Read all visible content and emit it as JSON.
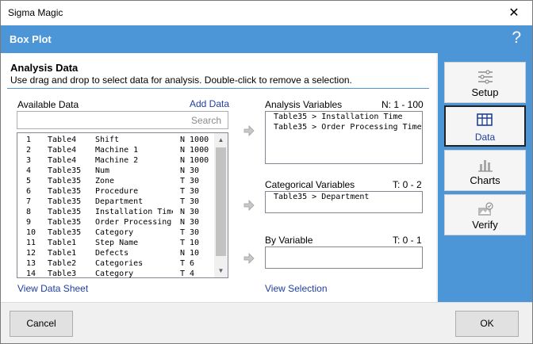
{
  "window": {
    "title": "Sigma Magic",
    "close_glyph": "✕"
  },
  "header": {
    "title": "Box Plot",
    "help": "?"
  },
  "section": {
    "title": "Analysis Data",
    "description": "Use drag and drop to select data for analysis. Double-click to remove a selection."
  },
  "available": {
    "label": "Available Data",
    "add_link": "Add Data",
    "search_placeholder": "Search",
    "rows": [
      [
        "1",
        "Table4",
        "Shift",
        "N 1000"
      ],
      [
        "2",
        "Table4",
        "Machine 1",
        "N 1000"
      ],
      [
        "3",
        "Table4",
        "Machine 2",
        "N 1000"
      ],
      [
        "4",
        "Table35",
        "Num",
        "N 30"
      ],
      [
        "5",
        "Table35",
        "Zone",
        "T 30"
      ],
      [
        "6",
        "Table35",
        "Procedure",
        "T 30"
      ],
      [
        "7",
        "Table35",
        "Department",
        "T 30"
      ],
      [
        "8",
        "Table35",
        "Installation Time",
        "N 30"
      ],
      [
        "9",
        "Table35",
        "Order Processing",
        "N 30"
      ],
      [
        "10",
        "Table35",
        "Category",
        "T 30"
      ],
      [
        "11",
        "Table1",
        "Step Name",
        "T 10"
      ],
      [
        "12",
        "Table1",
        "Defects",
        "N 10"
      ],
      [
        "13",
        "Table2",
        "Categories",
        "T 6"
      ],
      [
        "14",
        "Table3",
        "Category",
        "T 4"
      ]
    ],
    "view_link": "View Data Sheet"
  },
  "analysis_vars": {
    "label": "Analysis Variables",
    "range": "N: 1 - 100",
    "items": [
      "Table35 > Installation Time",
      "Table35 > Order Processing Time"
    ]
  },
  "categorical_vars": {
    "label": "Categorical Variables",
    "range": "T: 0 - 2",
    "items": [
      "Table35 > Department"
    ]
  },
  "by_variable": {
    "label": "By Variable",
    "range": "T: 0 - 1",
    "items": []
  },
  "view_selection": "View Selection",
  "nav": [
    {
      "label": "Setup",
      "icon": "sliders-icon",
      "active": false
    },
    {
      "label": "Data",
      "icon": "table-icon",
      "active": true
    },
    {
      "label": "Charts",
      "icon": "bar-chart-icon",
      "active": false
    },
    {
      "label": "Verify",
      "icon": "verify-icon",
      "active": false
    }
  ],
  "footer": {
    "cancel": "Cancel",
    "ok": "OK"
  },
  "colors": {
    "accent": "#4c96d7",
    "link": "#1f3fa0"
  }
}
